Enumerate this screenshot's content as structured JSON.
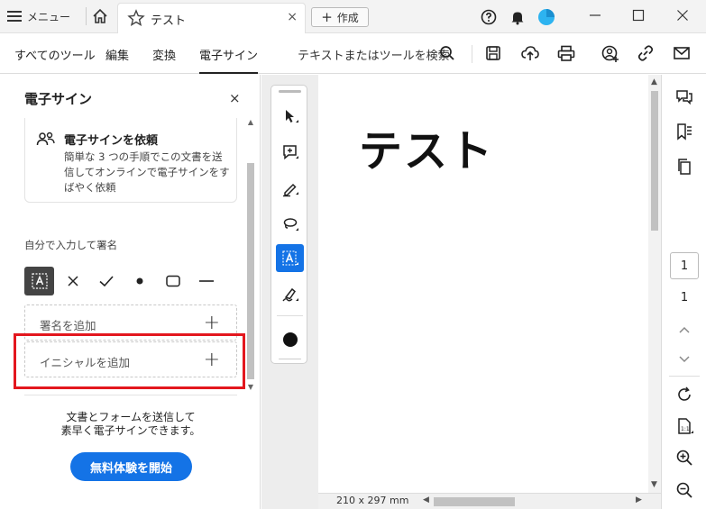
{
  "titlebar": {
    "menu_label": "メニュー",
    "tab_title": "テスト",
    "tab_close": "×",
    "new_button": "作成"
  },
  "toolbar": {
    "items": [
      "すべてのツール",
      "編集",
      "変換",
      "電子サイン"
    ],
    "active_item": "電子サイン",
    "search_placeholder": "テキストまたはツールを検索"
  },
  "panel": {
    "title": "電子サイン",
    "close": "×",
    "request_card": {
      "title": "電子サインを依頼",
      "description": "簡単な 3 つの手順でこの文書を送信してオンラインで電子サインをすばやく依頼"
    },
    "section_label": "自分で入力して署名",
    "type_tools": [
      "text-field",
      "cross-mark",
      "check-mark",
      "dot",
      "rectangle",
      "line"
    ],
    "add_signature": "署名を追加",
    "add_initials": "イニシャルを追加",
    "promo_line1": "文書とフォームを送信して",
    "promo_line2": "素早く電子サインできます。",
    "trial_button": "無料体験を開始"
  },
  "document": {
    "page_text": "テスト",
    "page_size": "210 x 297 mm"
  },
  "rail": {
    "current_page": "1",
    "total_pages": "1"
  },
  "colors": {
    "accent": "#1473e6",
    "highlight": "#e3171e"
  }
}
